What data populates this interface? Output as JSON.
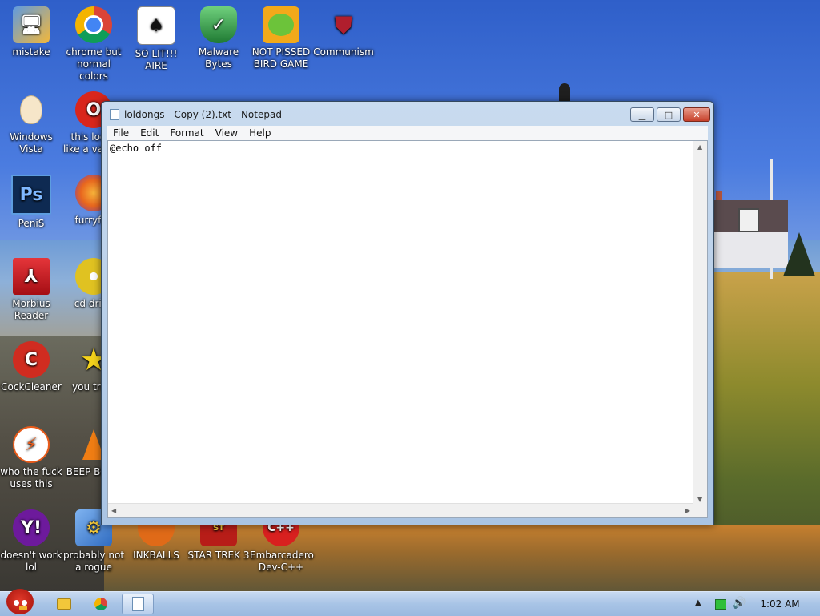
{
  "desktop": {
    "icons": [
      {
        "label": "mistake",
        "icon": "computer-folder-icon",
        "color": "#3a78c2"
      },
      {
        "label": "chrome but normal colors",
        "icon": "chrome-icon",
        "color": "#e2483c"
      },
      {
        "label": "SO LIT!!! AIRE",
        "icon": "solitaire-cards-icon",
        "color": "#2d2d2d"
      },
      {
        "label": "Malware Bytes",
        "icon": "shield-check-icon",
        "color": "#2f9a45"
      },
      {
        "label": "NOT PISSED BIRD GAME",
        "icon": "green-pig-icon",
        "color": "#f0a31a"
      },
      {
        "label": "Communism",
        "icon": "emblem-icon",
        "color": "#b01e2d"
      },
      {
        "label": "Windows Vista",
        "icon": "egg-icon",
        "color": "#f3d9b0"
      },
      {
        "label": "this looks like a vagina",
        "icon": "opera-icon",
        "color": "#d9261c"
      },
      {
        "label": "PeniS",
        "icon": "photoshop-icon",
        "color": "#0e3a6e"
      },
      {
        "label": "furryfox",
        "icon": "firefox-icon",
        "color": "#e8661e"
      },
      {
        "label": "Morbius Reader",
        "icon": "acrobat-icon",
        "color": "#c9141b"
      },
      {
        "label": "cd drive",
        "icon": "cd-icon",
        "color": "#e0c221"
      },
      {
        "label": "CockCleaner",
        "icon": "ccleaner-icon",
        "color": "#c92a1e"
      },
      {
        "label": "you tried",
        "icon": "star-icon",
        "color": "#f4d21c"
      },
      {
        "label": "who the fuck uses this",
        "icon": "lightning-icon",
        "color": "#e95b1a"
      },
      {
        "label": "BEEP BOOP",
        "icon": "traffic-cone-icon",
        "color": "#f07d13"
      },
      {
        "label": "doesn't work lol",
        "icon": "yahoo-icon",
        "color": "#6d1a9c"
      },
      {
        "label": "probably not a rogue",
        "icon": "gear-window-icon",
        "color": "#3b76c9"
      },
      {
        "label": "INKBALLS",
        "icon": "inkball-icon",
        "color": "#e06a18"
      },
      {
        "label": "STAR TREK 3",
        "icon": "star-trek-icon",
        "color": "#b71d18"
      },
      {
        "label": "Embarcadero Dev-C++",
        "icon": "devcpp-icon",
        "color": "#d8201f"
      }
    ]
  },
  "notepad": {
    "title": "loldongs - Copy (2).txt - Notepad",
    "menu": [
      "File",
      "Edit",
      "Format",
      "View",
      "Help"
    ],
    "content": "@echo off",
    "minimize_label": "▁",
    "maximize_label": "□",
    "close_label": "✕"
  },
  "taskbar": {
    "clock": "1:02 AM",
    "pinned": [
      "explorer-icon",
      "chrome-icon",
      "notepad-icon"
    ]
  }
}
